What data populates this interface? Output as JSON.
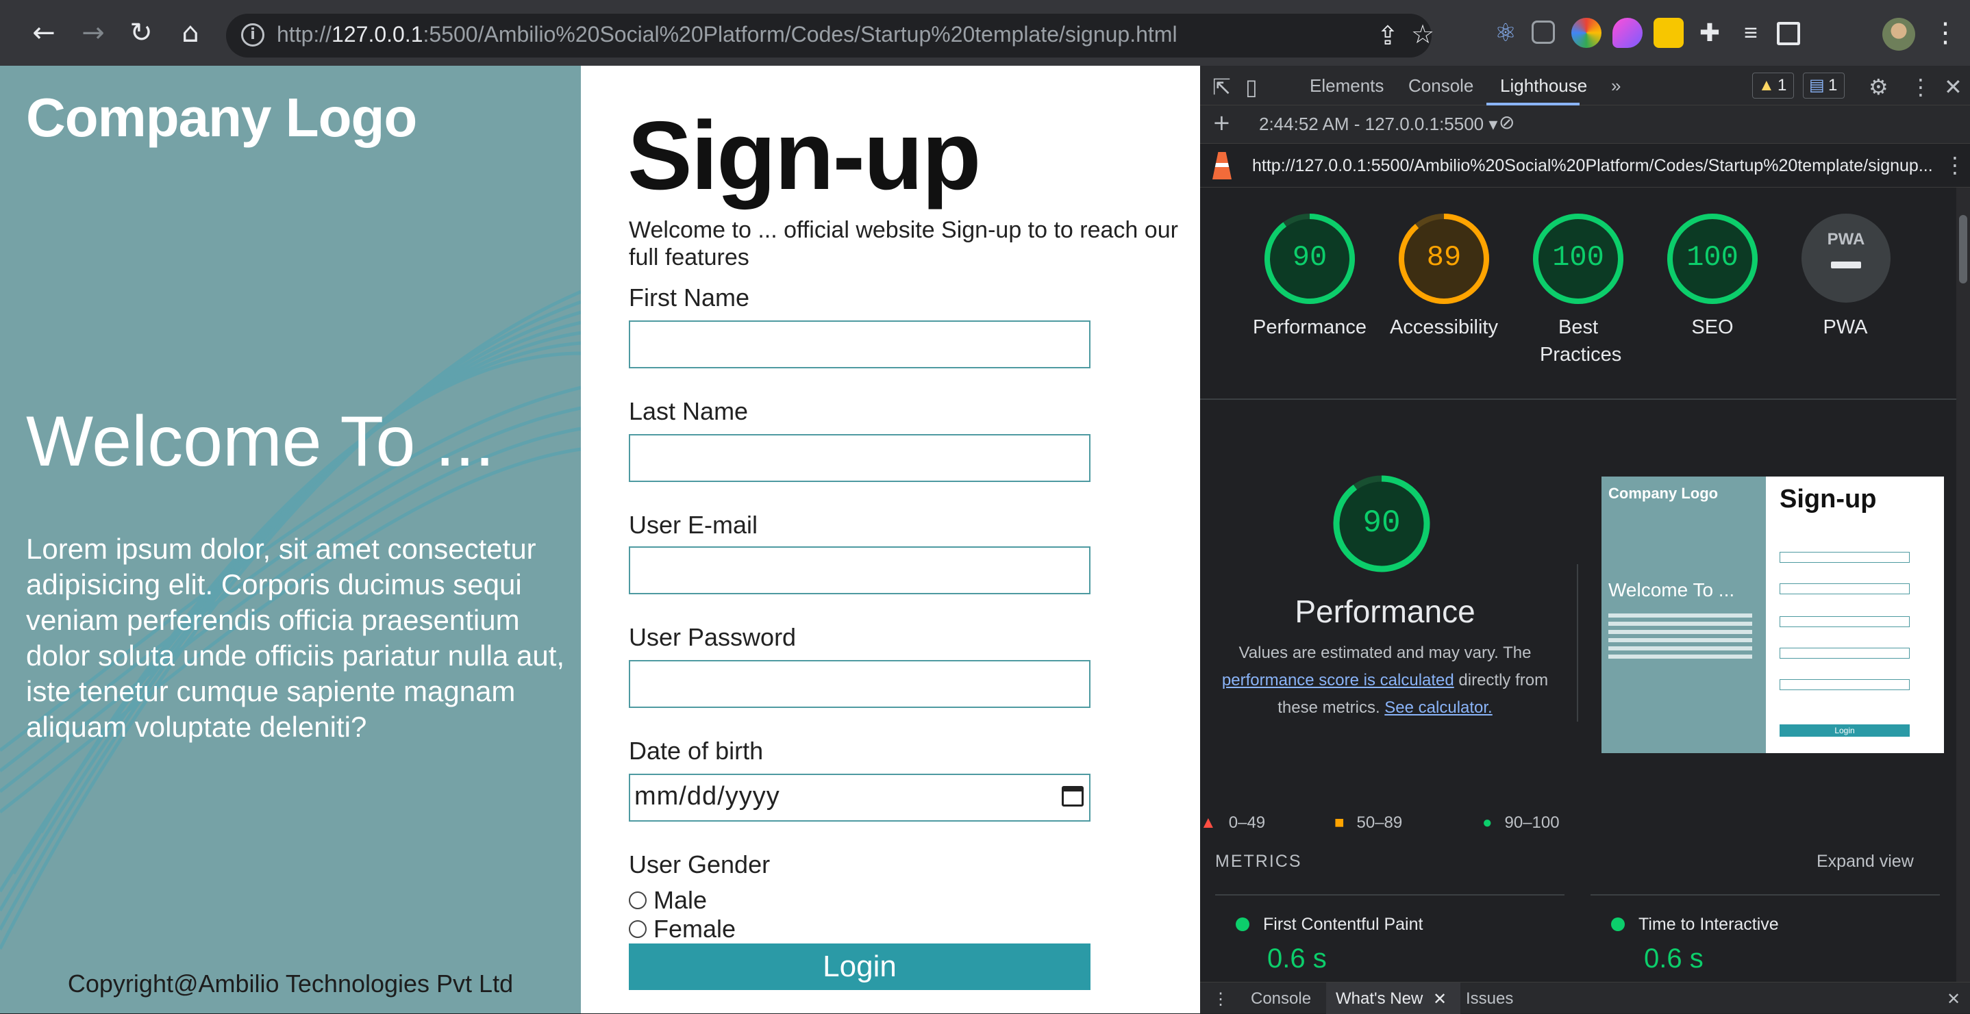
{
  "browser": {
    "url_prefix": "http://",
    "url_host": "127.0.0.1",
    "url_rest": ":5500/Ambilio%20Social%20Platform/Codes/Startup%20template/signup.html"
  },
  "hero": {
    "logo": "Company Logo",
    "welcome": "Welcome To ...",
    "lorem": "Lorem ipsum dolor, sit amet consectetur adipisicing elit. Corporis ducimus sequi veniam perferendis officia praesentium dolor soluta unde officiis pariatur nulla aut, iste tenetur cumque sapiente magnam aliquam voluptate deleniti?",
    "copyright": "Copyright@Ambilio Technologies Pvt Ltd"
  },
  "form": {
    "title": "Sign-up",
    "subtitle": "Welcome to ... official website Sign-up to to reach our full features",
    "first_name_label": "First Name",
    "last_name_label": "Last Name",
    "email_label": "User E-mail",
    "password_label": "User Password",
    "dob_label": "Date of birth",
    "dob_placeholder": "mm/dd/yyyy",
    "gender_label": "User Gender",
    "gender_options": [
      "Male",
      "Female"
    ],
    "login_button": "Login"
  },
  "devtools": {
    "tabs": [
      "Elements",
      "Console",
      "Lighthouse"
    ],
    "more_tabs": "»",
    "warning_count": "1",
    "issue_count": "1",
    "report_time": "2:44:52 AM - 127.0.0.1:5500",
    "report_url": "http://127.0.0.1:5500/Ambilio%20Social%20Platform/Codes/Startup%20template/signup...",
    "scores": [
      {
        "label": "Performance",
        "value": 90,
        "color": "#0cce6b"
      },
      {
        "label": "Accessibility",
        "value": 89,
        "color": "#ffa400"
      },
      {
        "label": "Best Practices",
        "value": 100,
        "color": "#0cce6b"
      },
      {
        "label": "SEO",
        "value": 100,
        "color": "#0cce6b"
      }
    ],
    "pwa_label": "PWA",
    "pwa_badge": "PWA",
    "big_score": 90,
    "big_title": "Performance",
    "note_1": "Values are estimated and may vary. The ",
    "note_link_1": "performance score is calculated",
    "note_2": " directly from these metrics. ",
    "note_link_2": "See calculator.",
    "legend": [
      "0–49",
      "50–89",
      "90–100"
    ],
    "metrics_header": "METRICS",
    "expand_view": "Expand view",
    "metrics": [
      {
        "name": "First Contentful Paint",
        "value": "0.6 s"
      },
      {
        "name": "Time to Interactive",
        "value": "0.6 s"
      }
    ],
    "drawer_tabs": [
      "Console",
      "What's New",
      "Issues"
    ],
    "thumbnail": {
      "logo": "Company Logo",
      "title": "Sign-up",
      "welcome": "Welcome To ...",
      "login": "Login"
    }
  }
}
